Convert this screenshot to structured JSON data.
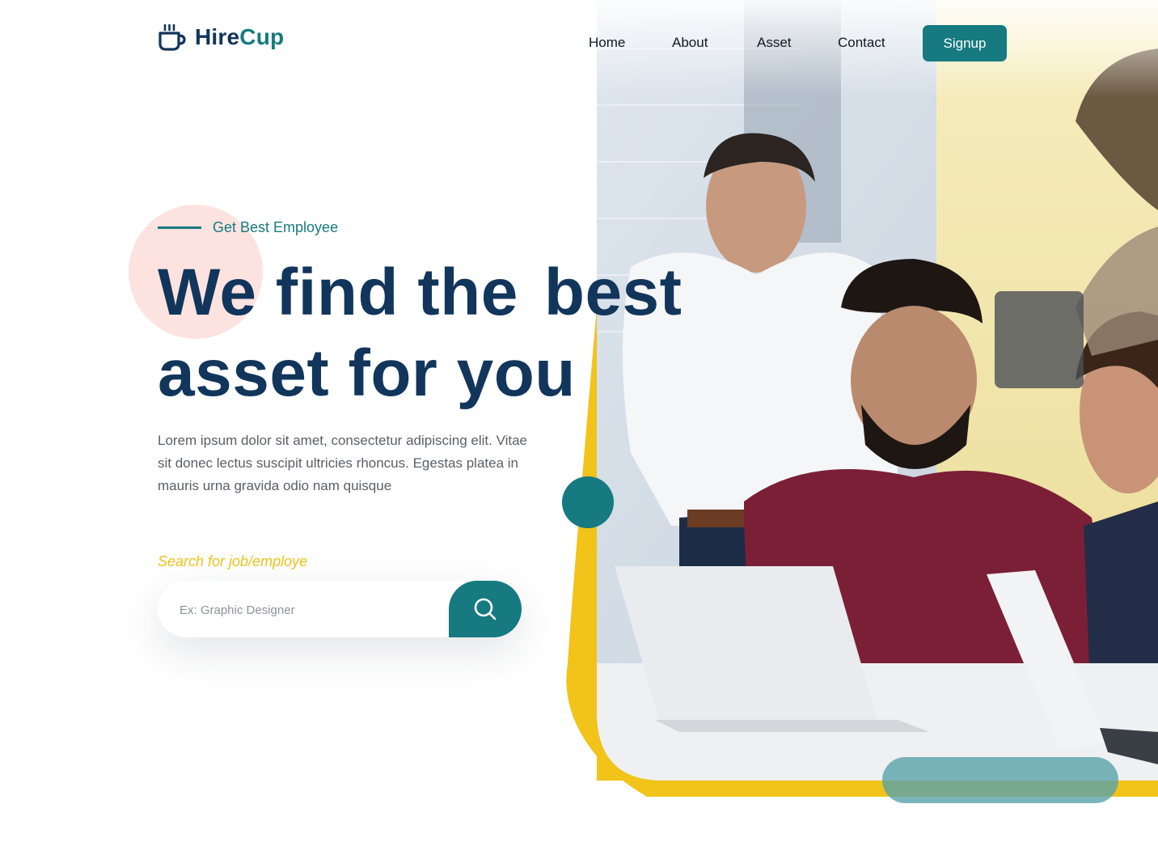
{
  "brand": {
    "name_part1": "Hire",
    "name_part2": "Cup",
    "logo_icon": "coffee-cup-icon"
  },
  "nav": {
    "items": [
      {
        "label": "Home"
      },
      {
        "label": "About"
      },
      {
        "label": "Asset"
      },
      {
        "label": "Contact"
      }
    ],
    "signup_label": "Signup"
  },
  "hero": {
    "eyebrow": "Get Best Employee",
    "headline_line1_prefix": "We find the",
    "headline_highlight": "best",
    "headline_line2": "asset for you",
    "description": "Lorem ipsum dolor sit amet, consectetur adipiscing elit. Vitae sit donec lectus suscipit ultricies rhoncus. Egestas platea in mauris urna gravida odio nam quisque",
    "image_alt": "Team of colleagues working together on laptops"
  },
  "search": {
    "label": "Search for job/employe",
    "placeholder": "Ex: Graphic Designer",
    "value": "",
    "button_icon": "search-icon"
  },
  "colors": {
    "primary_navy": "#12355b",
    "teal": "#167a80",
    "yellow": "#f0c21d",
    "pink": "#fde3e0",
    "text_gray": "#59606a"
  }
}
